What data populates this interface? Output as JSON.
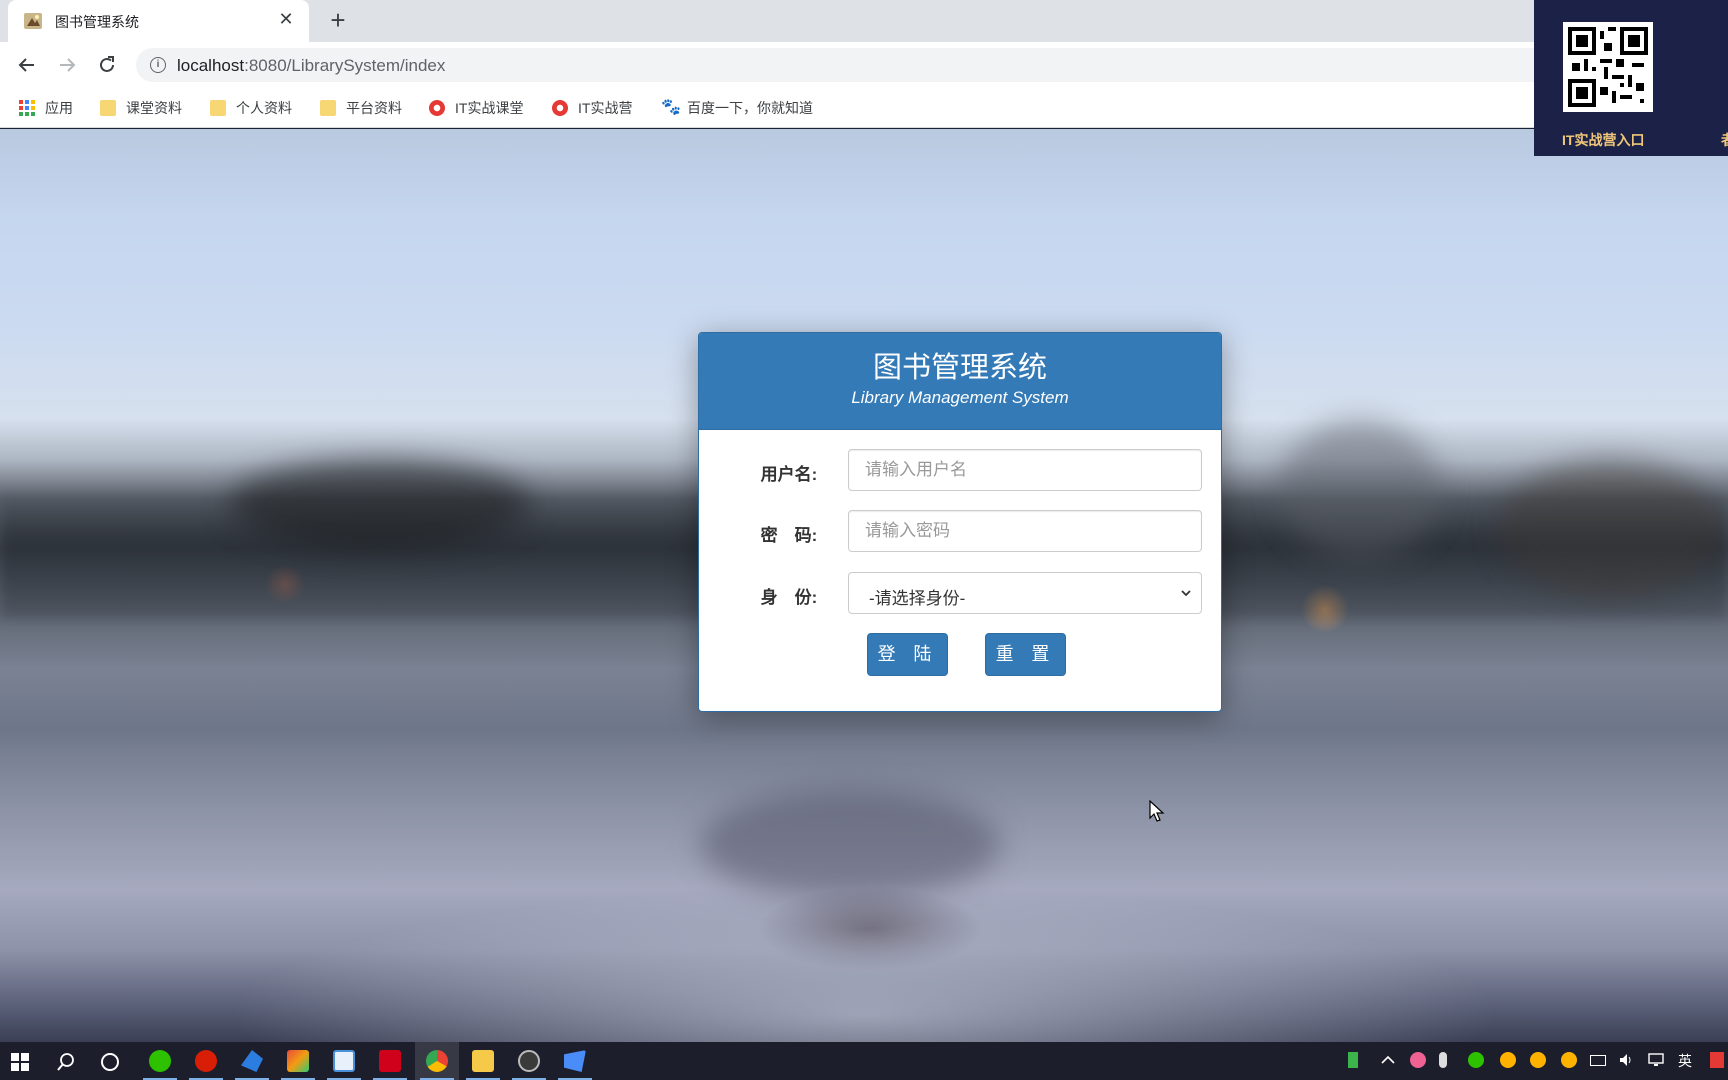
{
  "browser": {
    "tab_title": "图书管理系统",
    "close_glyph": "✕",
    "new_tab_glyph": "+",
    "url_host": "localhost",
    "url_rest": ":8080/LibrarySystem/index"
  },
  "bookmarks": [
    {
      "label": "应用",
      "icon": "apps-grid-icon"
    },
    {
      "label": "课堂资料",
      "icon": "folder-icon"
    },
    {
      "label": "个人资料",
      "icon": "folder-icon"
    },
    {
      "label": "平台资料",
      "icon": "folder-icon"
    },
    {
      "label": "IT实战课堂",
      "icon": "chrome-icon"
    },
    {
      "label": "IT实战营",
      "icon": "chrome-icon"
    },
    {
      "label": "百度一下，你就知道",
      "icon": "baidu-paw-icon"
    }
  ],
  "login": {
    "title": "图书管理系统",
    "subtitle": "Library Management System",
    "username_label": "用户名:",
    "username_placeholder": "请输入用户名",
    "password_label": "密　码:",
    "password_placeholder": "请输入密码",
    "role_label": "身　份:",
    "role_selected": "-请选择身份-",
    "login_button": "登 陆",
    "reset_button": "重 置"
  },
  "qr_overlay": {
    "label": "IT实战营入口",
    "label_cut": "者"
  },
  "taskbar": {
    "ime_label": "英"
  },
  "colors": {
    "primary": "#337ab7",
    "primary_border": "#2e6da4",
    "overlay_bg": "#1c2148",
    "overlay_text": "#f0c77a"
  }
}
